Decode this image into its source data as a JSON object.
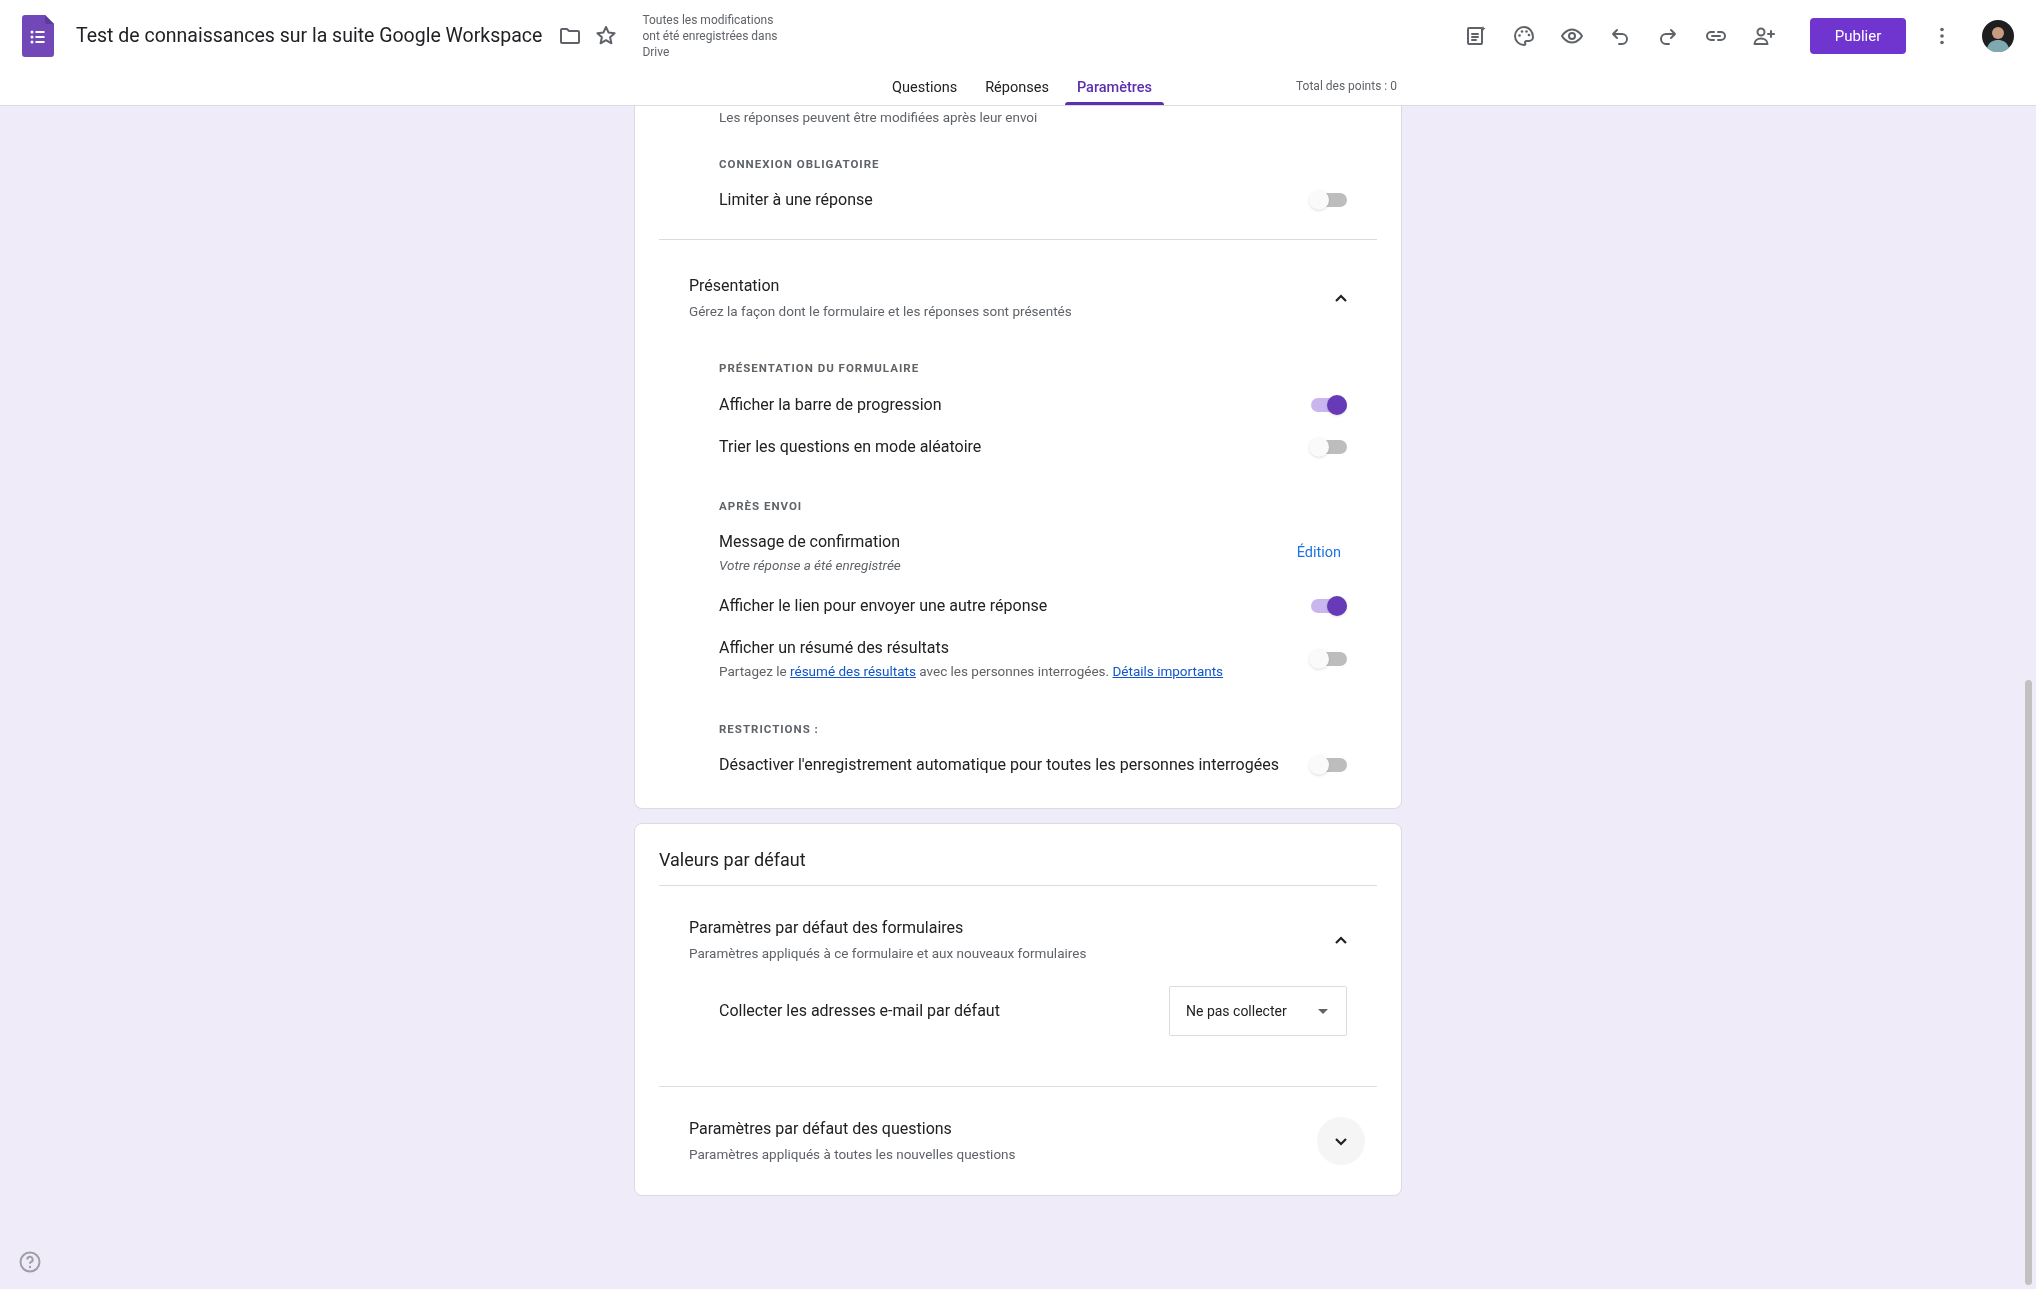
{
  "header": {
    "title": "Test de connaissances sur la suite Google Workspace",
    "save_status": "Toutes les modifications ont été enregistrées dans Drive",
    "publish_button": "Publier",
    "total_points": "Total des points : 0",
    "tabs": [
      {
        "label": "Questions",
        "selected": false
      },
      {
        "label": "Réponses",
        "selected": false
      },
      {
        "label": "Paramètres",
        "selected": true
      }
    ]
  },
  "cards": [
    {
      "leading_text": "Les réponses peuvent être modifiées après leur envoi",
      "items": [
        {
          "kind": "heading",
          "label": "CONNEXION OBLIGATOIRE"
        },
        {
          "kind": "toggle",
          "label": "Limiter à une réponse",
          "on": false
        },
        {
          "kind": "section",
          "title": "Présentation",
          "subtitle": "Gérez la façon dont le formulaire et les réponses sont présentés",
          "expanded": true
        },
        {
          "kind": "heading",
          "label": "PRÉSENTATION DU FORMULAIRE"
        },
        {
          "kind": "toggle",
          "label": "Afficher la barre de progression",
          "on": true
        },
        {
          "kind": "toggle",
          "label": "Trier les questions en mode aléatoire",
          "on": false
        },
        {
          "kind": "heading",
          "label": "APRÈS ENVOI"
        },
        {
          "kind": "edit",
          "label": "Message de confirmation",
          "value": "Votre réponse a été enregistrée",
          "action": "Édition"
        },
        {
          "kind": "toggle",
          "label": "Afficher le lien pour envoyer une autre réponse",
          "on": true
        },
        {
          "kind": "toggle",
          "label": "Afficher un résumé des résultats",
          "on": false,
          "description": [
            {
              "text": "Partagez le ",
              "link": false
            },
            {
              "text": "résumé des résultats",
              "link": true
            },
            {
              "text": " avec les personnes interrogées. ",
              "link": false
            },
            {
              "text": "Détails importants",
              "link": true
            }
          ]
        },
        {
          "kind": "heading",
          "label": "RESTRICTIONS :"
        },
        {
          "kind": "toggle",
          "label": "Désactiver l'enregistrement automatique pour toutes les personnes interrogées",
          "on": false
        }
      ]
    },
    {
      "title": "Valeurs par défaut",
      "items": [
        {
          "kind": "section",
          "title": "Paramètres par défaut des formulaires",
          "subtitle": "Paramètres appliqués à ce formulaire et aux nouveaux formulaires",
          "expanded": true
        },
        {
          "kind": "select",
          "label": "Collecter les adresses e-mail par défaut",
          "value": "Ne pas collecter"
        },
        {
          "kind": "section",
          "title": "Paramètres par défaut des questions",
          "subtitle": "Paramètres appliqués à toutes les nouvelles questions",
          "expanded": false
        }
      ]
    }
  ]
}
